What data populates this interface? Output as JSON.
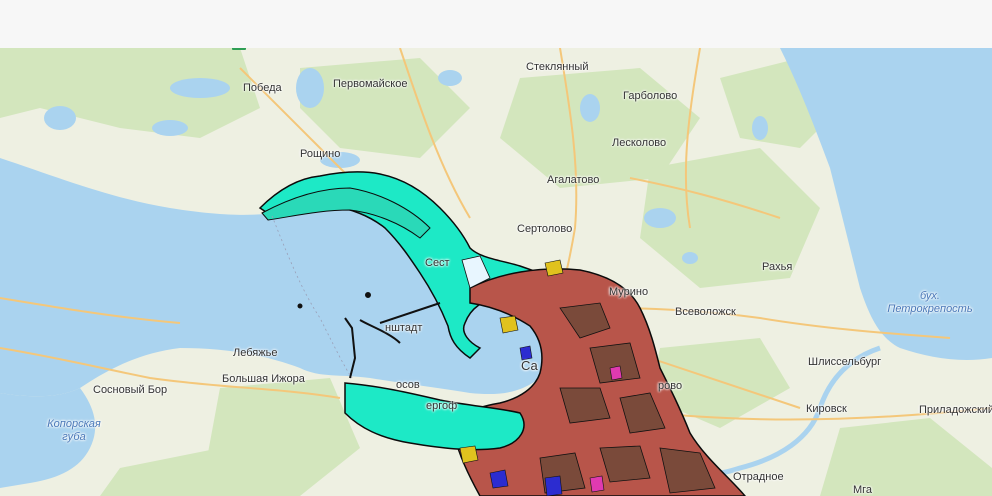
{
  "map": {
    "place_labels": [
      {
        "id": "steklyanny",
        "text": "Стеклянный"
      },
      {
        "id": "pobeda",
        "text": "Победа"
      },
      {
        "id": "pervomayskoe",
        "text": "Первомайское"
      },
      {
        "id": "garbolovo",
        "text": "Гарболово"
      },
      {
        "id": "leskolovo",
        "text": "Лесколово"
      },
      {
        "id": "roshchino",
        "text": "Рощино"
      },
      {
        "id": "agalatovo",
        "text": "Агалатово"
      },
      {
        "id": "sertolovo",
        "text": "Сертолово"
      },
      {
        "id": "sestroretsk",
        "text": "Сест"
      },
      {
        "id": "rakhya",
        "text": "Рахья"
      },
      {
        "id": "murino",
        "text": "Мурино"
      },
      {
        "id": "vsevolozhsk",
        "text": "Всеволожск"
      },
      {
        "id": "kronshtadt",
        "text": "нштадт"
      },
      {
        "id": "lebyazhye",
        "text": "Лебяжье"
      },
      {
        "id": "shlisselburg",
        "text": "Шлиссельбург"
      },
      {
        "id": "sosnovy_bor",
        "text": "Сосновый Бор"
      },
      {
        "id": "bolshaya_izhora",
        "text": "Большая Ижора"
      },
      {
        "id": "lomonosov",
        "text": "осов"
      },
      {
        "id": "spb",
        "text": "Са"
      },
      {
        "id": "kudrovo",
        "text": "рово"
      },
      {
        "id": "petergof",
        "text": "ергоф"
      },
      {
        "id": "kirovsk",
        "text": "Кировск"
      },
      {
        "id": "priladozhsky",
        "text": "Приладожский"
      },
      {
        "id": "otradnoe",
        "text": "Отрадное"
      },
      {
        "id": "mga",
        "text": "Мга"
      }
    ],
    "water_labels": [
      {
        "id": "petrokrepost",
        "line1": "бух.",
        "line2": "Петрокрепость"
      },
      {
        "id": "koporskaya",
        "line1": "Копорская",
        "line2": "губа"
      }
    ],
    "colors": {
      "land": "#eef0e2",
      "water": "#aad3ef",
      "forest": "#cfe5b9",
      "road": "#f4c77a",
      "parcel_cyan": "#1de9c6",
      "parcel_red": "#b8554a",
      "parcel_brown": "#7a4a3a"
    }
  }
}
